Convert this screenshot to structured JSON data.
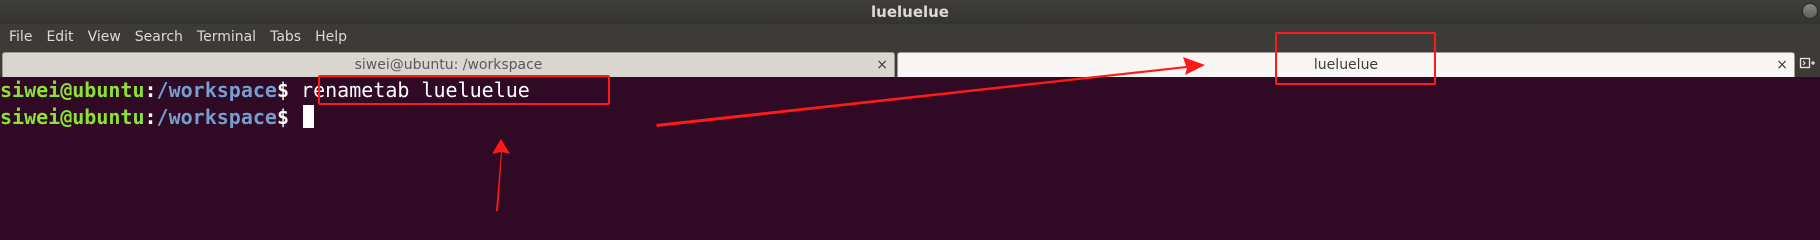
{
  "window": {
    "title": "lueluelue"
  },
  "menu": {
    "items": [
      "File",
      "Edit",
      "View",
      "Search",
      "Terminal",
      "Tabs",
      "Help"
    ]
  },
  "tabs": [
    {
      "label": "siwei@ubuntu: /workspace",
      "close": "×",
      "active": false
    },
    {
      "label": "lueluelue",
      "close": "×",
      "active": true
    }
  ],
  "new_tab_icon": "new-tab-icon",
  "terminal": {
    "lines": [
      {
        "user_host": "siwei@ubuntu",
        "sep": ":",
        "path": "/workspace",
        "prompt": "$",
        "command": " renametab lueluelue"
      },
      {
        "user_host": "siwei@ubuntu",
        "sep": ":",
        "path": "/workspace",
        "prompt": "$",
        "command": " "
      }
    ]
  },
  "colors": {
    "terminal_bg": "#300a24",
    "user_host": "#8ae234",
    "path": "#729fcf",
    "annotation": "#ff1a1a"
  }
}
